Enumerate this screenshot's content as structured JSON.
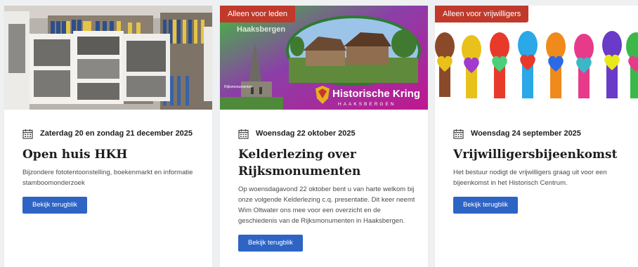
{
  "cards": [
    {
      "badge": "",
      "date": "Zaterdag 20 en zondag 21 december 2025",
      "title": "Open huis HKH",
      "description": "Bijzondere fototentoonstelling, boekenmarkt en informatie stamboomonderzoek",
      "button": "Bekijk terugblik",
      "image": "archive-room-photo"
    },
    {
      "badge": "Alleen voor leden",
      "date": "Woensdag 22 oktober 2025",
      "title": "Kelderlezing over Rijksmonumenten",
      "description": "Op woensdagavond 22 oktober bent u van harte welkom bij onze volgende Kelderlezing c.q. presentatie. Dit keer neemt Wim Oltwater ons mee voor een overzicht en de geschiedenis van de Rijksmonumenten in Haaksbergen.",
      "button": "Bekijk terugblik",
      "image": "rijksmonumenten-poster",
      "poster": {
        "top_text": "Haaksbergen",
        "inner_label": "Rijksmonumenten",
        "brand_name": "Historische Kring",
        "brand_sub": "HAAKSBERGEN"
      }
    },
    {
      "badge": "Alleen voor vrijwilligers",
      "date": "Woensdag 24 september 2025",
      "title": "Vrijwilligersbijeenkomst",
      "description": "Het bestuur nodigt de vrijwilligers graag uit voor een bijeenkomst in het Historisch Centrum.",
      "button": "Bekijk terugblik",
      "image": "colorful-hands-hearts"
    }
  ],
  "colors": {
    "badge": "#c0392b",
    "button": "#2e64c4",
    "title": "#1d1d1d"
  },
  "icons": {
    "date": "calendar-icon"
  }
}
